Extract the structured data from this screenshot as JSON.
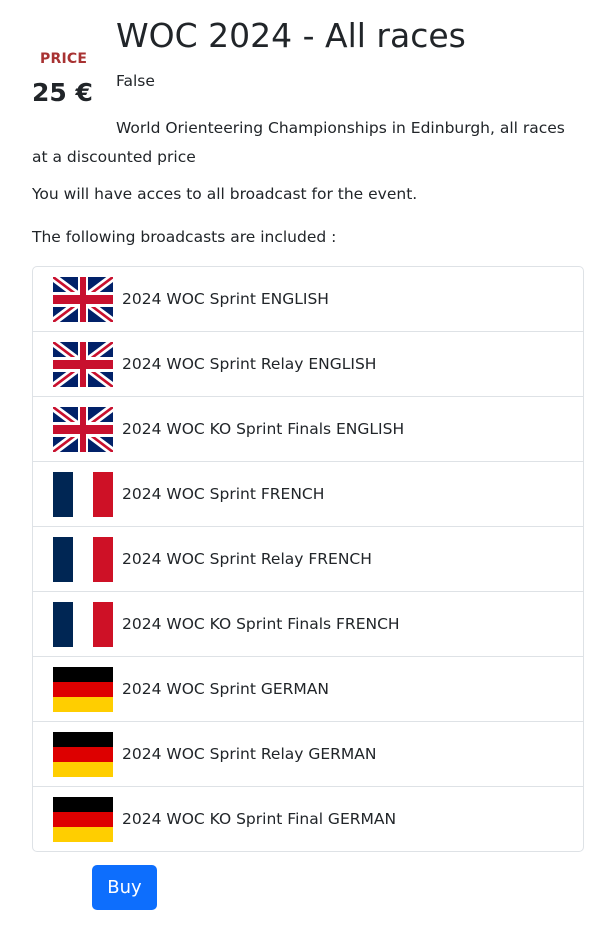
{
  "product": {
    "price_label": "PRICE",
    "price_value": "25 €",
    "title": "WOC 2024 - All races",
    "flag_text": "False",
    "description": "World Orienteering Championships in Edinburgh, all races at a discounted price",
    "access_text": "You will have acces to all broadcast for the event.",
    "included_text": "The following broadcasts are included :"
  },
  "broadcasts": [
    {
      "label": "2024 WOC Sprint ENGLISH",
      "flag": "uk-flag-icon"
    },
    {
      "label": "2024 WOC Sprint Relay ENGLISH",
      "flag": "uk-flag-icon"
    },
    {
      "label": "2024 WOC KO Sprint Finals ENGLISH",
      "flag": "uk-flag-icon"
    },
    {
      "label": "2024 WOC Sprint FRENCH",
      "flag": "france-flag-icon"
    },
    {
      "label": "2024 WOC Sprint Relay FRENCH",
      "flag": "france-flag-icon"
    },
    {
      "label": "2024 WOC KO Sprint Finals FRENCH",
      "flag": "france-flag-icon"
    },
    {
      "label": "2024 WOC Sprint GERMAN",
      "flag": "germany-flag-icon"
    },
    {
      "label": "2024 WOC Sprint Relay GERMAN",
      "flag": "germany-flag-icon"
    },
    {
      "label": "2024 WOC KO Sprint Final GERMAN",
      "flag": "germany-flag-icon"
    }
  ],
  "actions": {
    "buy_label": "Buy"
  },
  "colors": {
    "accent": "#0d6efd",
    "price_label": "#a83232",
    "uk_blue": "#012169",
    "uk_red": "#C8102E",
    "fr_blue": "#002654",
    "fr_red": "#CE1126",
    "de_black": "#000000",
    "de_red": "#DD0000",
    "de_gold": "#FFCE00"
  }
}
